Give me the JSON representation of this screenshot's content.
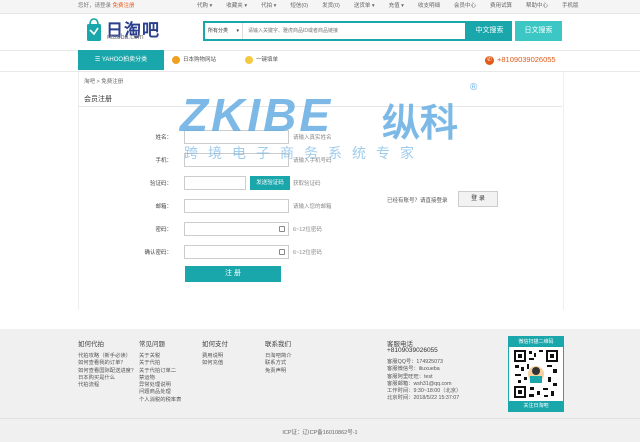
{
  "topbar": {
    "greeting": "您好，请登录",
    "register": "免费注册",
    "links": [
      "代购 ▾",
      "收藏夹 ▾",
      "代拍 ▾",
      "短信(0)",
      "发货(0)",
      "送货单 ▾",
      "充值 ▾",
      "收支明细",
      "会员中心",
      "费用试算",
      "帮助中心",
      "手机版"
    ]
  },
  "header": {
    "logo_title": "日淘吧",
    "logo_sub": "ritaoba.com",
    "search_category": "所有分类",
    "search_placeholder": "请输入关键字、雅虎商品ID或者商品链接",
    "search_cn": "中文搜索",
    "search_jp": "日文搜索"
  },
  "nav": {
    "yahoo": "YAHOO拍卖分类",
    "jp_sites": "日本购物网站",
    "one_click": "一键填单",
    "phone": "+8109039026055"
  },
  "breadcrumb": "淘吧 > 免费注册",
  "page_title": "会员注册",
  "watermark": {
    "brand": "ZKIBE",
    "brand_cn": "纵科",
    "reg": "®",
    "slogan": "跨境电子商务系统专家"
  },
  "form": {
    "name_label": "姓名：",
    "name_hint": "请输入真实姓名",
    "mobile_label": "手机：",
    "mobile_hint": "请输入手机号码",
    "code_label": "验证码：",
    "code_btn": "发送验证码",
    "code_hint": "获取验证码",
    "email_label": "邮箱：",
    "email_hint": "请输入您的邮箱",
    "pwd_label": "密码：",
    "pwd_hint": "6~12位密码",
    "pwd2_label": "确认密码：",
    "pwd2_hint": "6~12位密码",
    "register_btn": "注 册"
  },
  "login": {
    "prompt": "已经有账号？请直接登录",
    "button": "登 录"
  },
  "footer": {
    "columns": [
      {
        "title": "如何代拍",
        "items": [
          "代拍攻略（新手必读）",
          "如何查看我的订单？",
          "如何查看国际配送进度？",
          "日本购买是什么",
          "代拍流程"
        ]
      },
      {
        "title": "常见问题",
        "items": [
          "关于关税",
          "关于代拍",
          "关于代拍订单二",
          "禁运物",
          "异常处理说明",
          "问题商品处理",
          "个人消税的税率表"
        ]
      },
      {
        "title": "如何支付",
        "items": [
          "费用说明",
          "如何充值"
        ]
      },
      {
        "title": "联系我们",
        "items": [
          "日淘吧简介",
          "联系方式",
          "免责声明"
        ]
      }
    ],
    "service": {
      "title": "客服电话",
      "phone": "+8109039026055",
      "lines": [
        "客服QQ号：174925073",
        "客服微信号：iliuxueba",
        "客服阿里旺旺：test",
        "客服邮箱：wsh31@qq.com",
        "工作时间：9:30~18:00（北京）",
        "北京时间：2018/5/22 15:37:07"
      ]
    },
    "qr_top": "微信扫描二维码",
    "qr_bottom": "关注日淘吧",
    "icp": "ICP证：辽ICP备16010862号-1"
  }
}
